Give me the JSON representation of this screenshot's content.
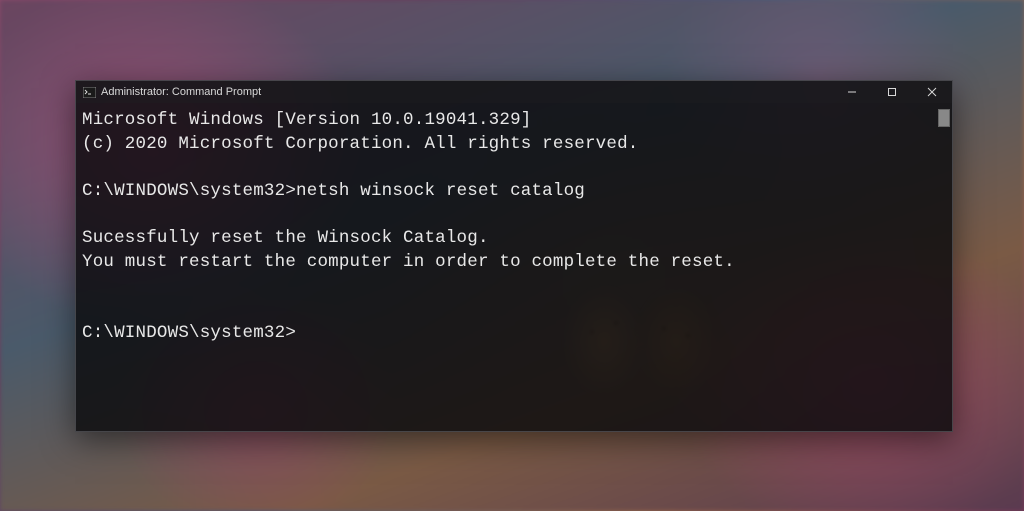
{
  "titlebar": {
    "title": "Administrator: Command Prompt"
  },
  "terminal": {
    "lines": {
      "l0": "Microsoft Windows [Version 10.0.19041.329]",
      "l1": "(c) 2020 Microsoft Corporation. All rights reserved.",
      "l2": "",
      "l3_prompt": "C:\\WINDOWS\\system32>",
      "l3_cmd": "netsh winsock reset catalog",
      "l4": "",
      "l5": "Sucessfully reset the Winsock Catalog.",
      "l6": "You must restart the computer in order to complete the reset.",
      "l7": "",
      "l8": "",
      "l9_prompt": "C:\\WINDOWS\\system32>"
    }
  }
}
